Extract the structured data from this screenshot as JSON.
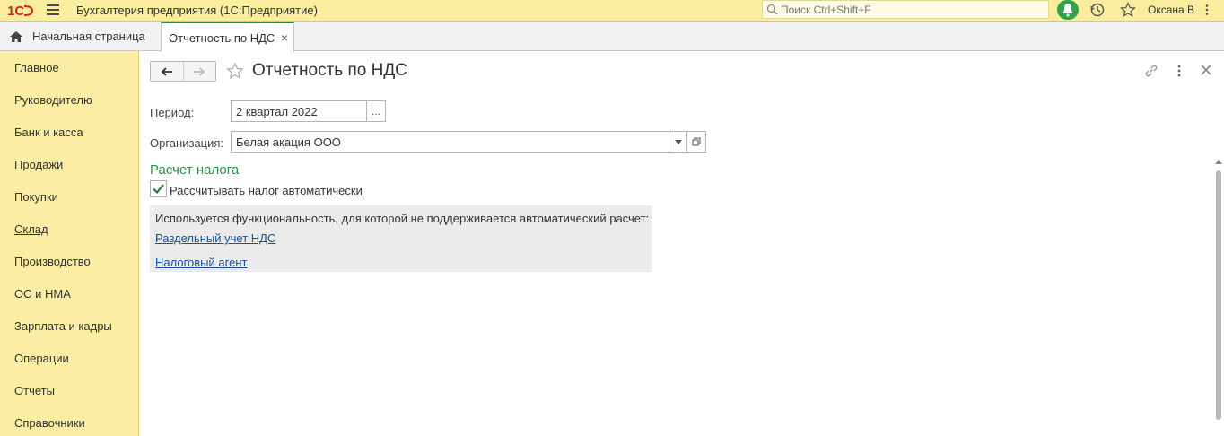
{
  "app": {
    "title": "Бухгалтерия предприятия  (1С:Предприятие)",
    "logo_text": "1С",
    "search_placeholder": "Поиск Ctrl+Shift+F",
    "user": "Оксана В"
  },
  "tabs": {
    "home_label": "Начальная страница",
    "active_label": "Отчетность по НДС",
    "close_glyph": "×"
  },
  "sidebar": {
    "items": [
      {
        "label": "Главное"
      },
      {
        "label": "Руководителю"
      },
      {
        "label": "Банк и касса"
      },
      {
        "label": "Продажи"
      },
      {
        "label": "Покупки"
      },
      {
        "label": "Склад"
      },
      {
        "label": "Производство"
      },
      {
        "label": "ОС и НМА"
      },
      {
        "label": "Зарплата и кадры"
      },
      {
        "label": "Операции"
      },
      {
        "label": "Отчеты"
      },
      {
        "label": "Справочники"
      }
    ]
  },
  "form": {
    "title": "Отчетность по НДС",
    "period_label": "Период:",
    "period_value": "2 квартал 2022",
    "period_btn": "...",
    "org_label": "Организация:",
    "org_value": "Белая акация ООО",
    "section_title": "Расчет налога",
    "auto_calc_label": "Рассчитывать налог автоматически",
    "auto_calc_checked": true,
    "info_text": "Используется функциональность, для которой не поддерживается автоматический расчет:",
    "link_separate": "Раздельный учет НДС",
    "link_agent": "Налоговый агент"
  },
  "colors": {
    "topbar": "#fbed9e",
    "sidebar": "#fbeda3",
    "accent_green": "#2a9346",
    "link": "#1a4f9c"
  }
}
